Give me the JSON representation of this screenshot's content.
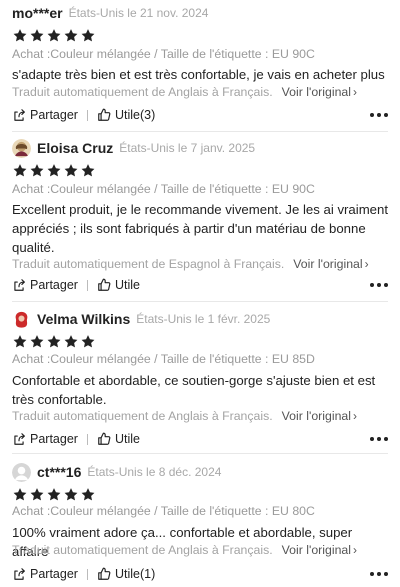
{
  "icons": {
    "star": "star-icon",
    "share": "share-icon",
    "thumb": "thumbs-up-icon",
    "more": "more-icon",
    "chevron": "chevron-right-icon"
  },
  "colors": {
    "star": "#222222",
    "avatar1": "#c0a070",
    "avatar2": "#cc2a2a",
    "avatar3": "#d0d0d0"
  },
  "labels": {
    "share": "Partager",
    "see_original": "Voir l'original",
    "chevron": "›"
  },
  "reviews": [
    {
      "name": "mo***er",
      "meta": "États-Unis le 21 nov. 2024",
      "rating": 5,
      "variant": "Achat :Couleur mélangée / Taille de l'étiquette : EU 90C",
      "text": "s'adapte très bien et est très confortable, je vais en acheter plus",
      "translation": "Traduit automatiquement de Anglais à Français.",
      "helpful": "Utile(3)"
    },
    {
      "name": "Eloisa Cruz",
      "meta": "États-Unis le 7 janv. 2025",
      "rating": 5,
      "variant": "Achat :Couleur mélangée / Taille de l'étiquette : EU 90C",
      "text": "Excellent produit, je le recommande vivement. Je les ai vraiment appréciés ; ils sont fabriqués à partir d'un matériau de bonne qualité.",
      "translation": "Traduit automatiquement de Espagnol à Français.",
      "helpful": "Utile"
    },
    {
      "name": "Velma Wilkins",
      "meta": "États-Unis le 1 févr. 2025",
      "rating": 5,
      "variant": "Achat :Couleur mélangée / Taille de l'étiquette : EU 85D",
      "text": "Confortable et abordable, ce soutien-gorge s'ajuste bien et est très confortable.",
      "translation": "Traduit automatiquement de Anglais à Français.",
      "helpful": "Utile"
    },
    {
      "name": "ct***16",
      "meta": "États-Unis le 8 déc. 2024",
      "rating": 5,
      "variant": "Achat :Couleur mélangée / Taille de l'étiquette : EU 80C",
      "text": "100% vraiment adore ça... confortable et abordable, super affaire",
      "translation": "Traduit automatiquement de Anglais à Français.",
      "helpful": "Utile(1)"
    }
  ]
}
